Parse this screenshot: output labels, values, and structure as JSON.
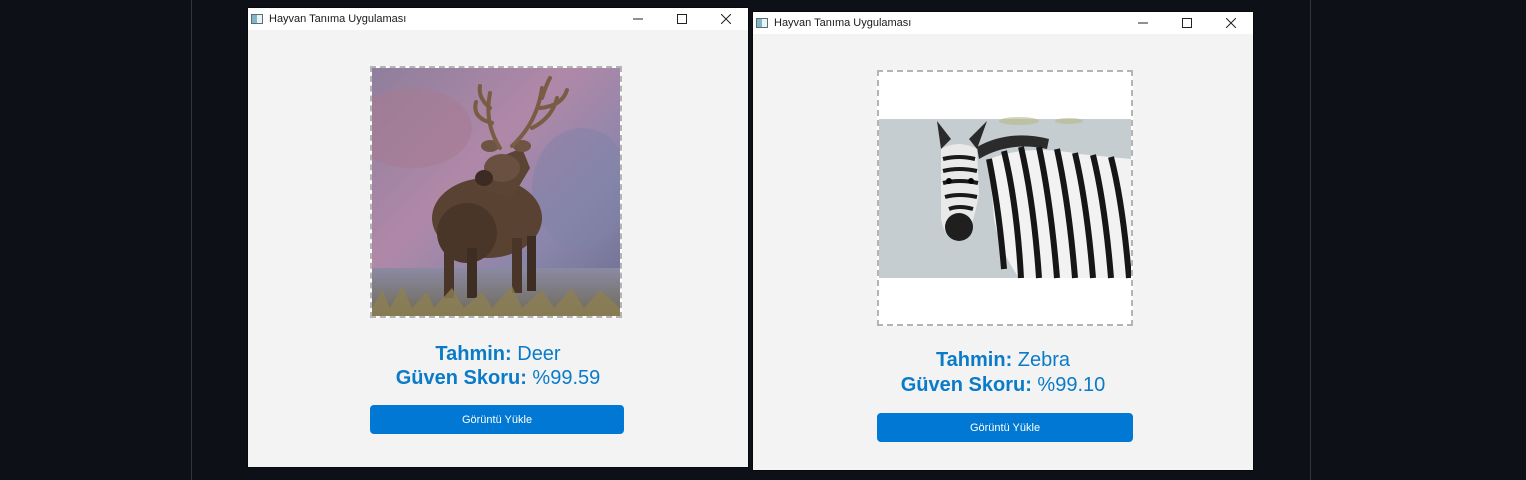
{
  "windows": [
    {
      "title": "Hayvan Tanıma Uygulaması",
      "controls": {
        "minimize": "─",
        "maximize": "☐",
        "close": "✕"
      },
      "prediction_label": "Tahmin:",
      "prediction_value": " Deer",
      "score_label": "Güven Skoru:",
      "score_value": " %99.59",
      "upload_button": "Görüntü Yükle",
      "image_subject": "deer"
    },
    {
      "title": "Hayvan Tanıma Uygulaması",
      "controls": {
        "minimize": "─",
        "maximize": "☐",
        "close": "✕"
      },
      "prediction_label": "Tahmin:",
      "prediction_value": " Zebra",
      "score_label": "Güven Skoru:",
      "score_value": " %99.10",
      "upload_button": "Görüntü Yükle",
      "image_subject": "zebra"
    }
  ],
  "colors": {
    "accent": "#0078d4",
    "result_text": "#0a7bc8",
    "background": "#0d1117",
    "window_body": "#f3f3f3"
  }
}
